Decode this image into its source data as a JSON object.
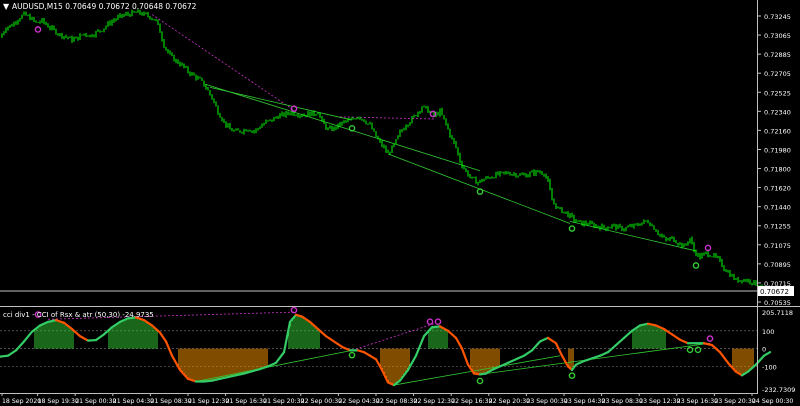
{
  "colors": {
    "background": "#000000",
    "candle": "#00ff00",
    "axis": "#c0c0c0",
    "text": "#ffffff",
    "divergence_line": "#cc33cc",
    "trend_line": "#33cc33",
    "cci_up": "#33cc66",
    "cci_down": "#ff5500",
    "hist_up": "#33cc33",
    "hist_down": "#ff9900",
    "bid_label_bg": "#ffffff"
  },
  "main_chart": {
    "header": "AUDUSD,M15  0.70649 0.70672 0.70648 0.70672",
    "bid_label": "0.70672",
    "price_labels": [
      "0.73245",
      "0.73065",
      "0.72885",
      "0.72705",
      "0.72525",
      "0.72340",
      "0.72160",
      "0.71980",
      "0.71800",
      "0.71620",
      "0.71440",
      "0.71255",
      "0.71075",
      "0.70895",
      "0.70715",
      "0.70535"
    ]
  },
  "indicator": {
    "header": "cci div1 - CCI of Rsx & atr (50,30) -24.9735",
    "level_labels": [
      "205.7118",
      "100",
      "0",
      "-100",
      "-232.7309"
    ]
  },
  "time_labels": [
    "18 Sep 2020",
    "18 Sep 19:30",
    "21 Sep 00:30",
    "21 Sep 04:30",
    "21 Sep 08:30",
    "21 Sep 12:30",
    "21 Sep 16:30",
    "21 Sep 20:30",
    "22 Sep 00:30",
    "22 Sep 04:30",
    "22 Sep 08:30",
    "22 Sep 12:30",
    "22 Sep 16:30",
    "22 Sep 20:30",
    "23 Sep 00:30",
    "23 Sep 04:30",
    "23 Sep 08:30",
    "23 Sep 12:30",
    "23 Sep 16:30",
    "23 Sep 20:30",
    "24 Sep 00:30"
  ],
  "chart_data": {
    "type": "candlestick",
    "symbol": "AUDUSD",
    "timeframe": "M15",
    "ohlc_last": {
      "open": 0.70649,
      "high": 0.70672,
      "low": 0.70648,
      "close": 0.70672
    },
    "ylim": [
      0.70535,
      0.73245
    ],
    "price_path": [
      [
        0,
        0.7302
      ],
      [
        6,
        0.7312
      ],
      [
        12,
        0.7314
      ],
      [
        18,
        0.732
      ],
      [
        24,
        0.7324
      ],
      [
        30,
        0.7321
      ],
      [
        36,
        0.7316
      ],
      [
        42,
        0.7318
      ],
      [
        48,
        0.7313
      ],
      [
        54,
        0.7309
      ],
      [
        60,
        0.7305
      ],
      [
        66,
        0.7303
      ],
      [
        72,
        0.73
      ],
      [
        78,
        0.7302
      ],
      [
        84,
        0.7306
      ],
      [
        90,
        0.7304
      ],
      [
        96,
        0.7307
      ],
      [
        102,
        0.731
      ],
      [
        108,
        0.7315
      ],
      [
        114,
        0.7319
      ],
      [
        120,
        0.7322
      ],
      [
        126,
        0.7324
      ],
      [
        132,
        0.7325
      ],
      [
        138,
        0.7326
      ],
      [
        144,
        0.7324
      ],
      [
        150,
        0.7322
      ],
      [
        156,
        0.7318
      ],
      [
        160,
        0.7308
      ],
      [
        164,
        0.7295
      ],
      [
        170,
        0.7285
      ],
      [
        176,
        0.728
      ],
      [
        182,
        0.7276
      ],
      [
        188,
        0.727
      ],
      [
        194,
        0.7266
      ],
      [
        200,
        0.7262
      ],
      [
        206,
        0.7255
      ],
      [
        212,
        0.7245
      ],
      [
        218,
        0.7232
      ],
      [
        224,
        0.7222
      ],
      [
        230,
        0.7215
      ],
      [
        236,
        0.7213
      ],
      [
        242,
        0.7214
      ],
      [
        248,
        0.7216
      ],
      [
        254,
        0.7213
      ],
      [
        260,
        0.7218
      ],
      [
        266,
        0.7222
      ],
      [
        272,
        0.7224
      ],
      [
        278,
        0.7228
      ],
      [
        284,
        0.7229
      ],
      [
        290,
        0.7231
      ],
      [
        296,
        0.723
      ],
      [
        302,
        0.7229
      ],
      [
        308,
        0.723
      ],
      [
        314,
        0.723
      ],
      [
        318,
        0.7232
      ],
      [
        322,
        0.7222
      ],
      [
        328,
        0.7215
      ],
      [
        334,
        0.7216
      ],
      [
        340,
        0.722
      ],
      [
        346,
        0.7223
      ],
      [
        352,
        0.7224
      ],
      [
        358,
        0.7228
      ],
      [
        364,
        0.7224
      ],
      [
        370,
        0.7219
      ],
      [
        376,
        0.7208
      ],
      [
        382,
        0.72
      ],
      [
        388,
        0.7192
      ],
      [
        394,
        0.72
      ],
      [
        400,
        0.7212
      ],
      [
        406,
        0.722
      ],
      [
        412,
        0.7225
      ],
      [
        418,
        0.7232
      ],
      [
        422,
        0.7237
      ],
      [
        428,
        0.7233
      ],
      [
        434,
        0.7228
      ],
      [
        440,
        0.7232
      ],
      [
        446,
        0.722
      ],
      [
        450,
        0.721
      ],
      [
        456,
        0.7198
      ],
      [
        460,
        0.7185
      ],
      [
        466,
        0.7175
      ],
      [
        472,
        0.7168
      ],
      [
        478,
        0.7165
      ],
      [
        484,
        0.7168
      ],
      [
        490,
        0.717
      ],
      [
        496,
        0.7172
      ],
      [
        502,
        0.7173
      ],
      [
        508,
        0.7174
      ],
      [
        514,
        0.7173
      ],
      [
        520,
        0.7172
      ],
      [
        526,
        0.7172
      ],
      [
        532,
        0.7174
      ],
      [
        538,
        0.7175
      ],
      [
        544,
        0.7174
      ],
      [
        548,
        0.7165
      ],
      [
        552,
        0.7148
      ],
      [
        558,
        0.714
      ],
      [
        564,
        0.7137
      ],
      [
        570,
        0.7133
      ],
      [
        576,
        0.7128
      ],
      [
        582,
        0.7126
      ],
      [
        588,
        0.7126
      ],
      [
        594,
        0.7124
      ],
      [
        600,
        0.7123
      ],
      [
        606,
        0.7122
      ],
      [
        612,
        0.7124
      ],
      [
        618,
        0.7122
      ],
      [
        624,
        0.7121
      ],
      [
        630,
        0.7123
      ],
      [
        636,
        0.7124
      ],
      [
        642,
        0.7127
      ],
      [
        648,
        0.7128
      ],
      [
        654,
        0.7122
      ],
      [
        660,
        0.7115
      ],
      [
        666,
        0.711
      ],
      [
        672,
        0.7112
      ],
      [
        678,
        0.7108
      ],
      [
        684,
        0.7104
      ],
      [
        690,
        0.7112
      ],
      [
        694,
        0.71
      ],
      [
        700,
        0.7094
      ],
      [
        706,
        0.7098
      ],
      [
        712,
        0.7096
      ],
      [
        718,
        0.7092
      ],
      [
        724,
        0.7084
      ],
      [
        730,
        0.7078
      ],
      [
        736,
        0.7072
      ],
      [
        742,
        0.7073
      ],
      [
        748,
        0.7072
      ],
      [
        754,
        0.707
      ],
      [
        760,
        0.7066
      ],
      [
        766,
        0.7062
      ],
      [
        770,
        0.7067
      ]
    ],
    "trend_lines": [
      {
        "kind": "divergence",
        "from": [
          152,
          0.7324
        ],
        "to": [
          296,
          0.7232
        ]
      },
      {
        "kind": "divergence",
        "from": [
          340,
          0.7227
        ],
        "to": [
          434,
          0.7225
        ]
      },
      {
        "kind": "trend",
        "from": [
          205,
          0.7258
        ],
        "to": [
          480,
          0.7176
        ]
      },
      {
        "kind": "trend",
        "from": [
          210,
          0.7255
        ],
        "to": [
          352,
          0.7224
        ]
      },
      {
        "kind": "trend",
        "from": [
          388,
          0.7192
        ],
        "to": [
          570,
          0.7126
        ]
      },
      {
        "kind": "trend",
        "from": [
          570,
          0.7128
        ],
        "to": [
          696,
          0.71
        ]
      }
    ],
    "arrows_main": [
      {
        "x": 38,
        "price": 0.7307,
        "kind": "top"
      },
      {
        "x": 294,
        "price": 0.7232,
        "kind": "top"
      },
      {
        "x": 433,
        "price": 0.7227,
        "kind": "top"
      },
      {
        "x": 708,
        "price": 0.71,
        "kind": "top"
      },
      {
        "x": 352,
        "price": 0.722,
        "kind": "bottom"
      },
      {
        "x": 480,
        "price": 0.716,
        "kind": "bottom"
      },
      {
        "x": 572,
        "price": 0.7125,
        "kind": "bottom"
      },
      {
        "x": 696,
        "price": 0.709,
        "kind": "bottom"
      }
    ],
    "indicator_ylim": [
      -232.7309,
      205.7118
    ],
    "indicator_levels": [
      100,
      0,
      -100
    ],
    "cci_path": [
      [
        0,
        -45
      ],
      [
        8,
        -40
      ],
      [
        16,
        -10
      ],
      [
        24,
        40
      ],
      [
        32,
        95
      ],
      [
        40,
        130
      ],
      [
        48,
        150
      ],
      [
        56,
        160
      ],
      [
        64,
        145
      ],
      [
        72,
        110
      ],
      [
        80,
        70
      ],
      [
        88,
        45
      ],
      [
        96,
        48
      ],
      [
        104,
        80
      ],
      [
        112,
        120
      ],
      [
        120,
        150
      ],
      [
        128,
        170
      ],
      [
        136,
        175
      ],
      [
        144,
        160
      ],
      [
        152,
        130
      ],
      [
        160,
        90
      ],
      [
        166,
        40
      ],
      [
        172,
        -40
      ],
      [
        180,
        -120
      ],
      [
        188,
        -170
      ],
      [
        196,
        -185
      ],
      [
        204,
        -185
      ],
      [
        212,
        -180
      ],
      [
        220,
        -170
      ],
      [
        228,
        -160
      ],
      [
        236,
        -150
      ],
      [
        244,
        -140
      ],
      [
        252,
        -128
      ],
      [
        260,
        -115
      ],
      [
        268,
        -100
      ],
      [
        276,
        -80
      ],
      [
        284,
        -20
      ],
      [
        290,
        150
      ],
      [
        296,
        190
      ],
      [
        302,
        180
      ],
      [
        310,
        150
      ],
      [
        318,
        110
      ],
      [
        326,
        70
      ],
      [
        334,
        40
      ],
      [
        342,
        10
      ],
      [
        350,
        -10
      ],
      [
        358,
        -10
      ],
      [
        364,
        -20
      ],
      [
        370,
        -40
      ],
      [
        376,
        -60
      ],
      [
        382,
        -120
      ],
      [
        388,
        -190
      ],
      [
        394,
        -205
      ],
      [
        400,
        -180
      ],
      [
        408,
        -120
      ],
      [
        416,
        -40
      ],
      [
        424,
        70
      ],
      [
        432,
        120
      ],
      [
        440,
        125
      ],
      [
        448,
        100
      ],
      [
        456,
        60
      ],
      [
        462,
        0
      ],
      [
        468,
        -90
      ],
      [
        474,
        -140
      ],
      [
        480,
        -145
      ],
      [
        486,
        -140
      ],
      [
        492,
        -120
      ],
      [
        500,
        -100
      ],
      [
        508,
        -80
      ],
      [
        516,
        -60
      ],
      [
        524,
        -40
      ],
      [
        532,
        -10
      ],
      [
        540,
        40
      ],
      [
        548,
        60
      ],
      [
        556,
        30
      ],
      [
        562,
        -40
      ],
      [
        568,
        -100
      ],
      [
        572,
        -120
      ],
      [
        576,
        -90
      ],
      [
        584,
        -70
      ],
      [
        592,
        -55
      ],
      [
        600,
        -40
      ],
      [
        608,
        -20
      ],
      [
        616,
        20
      ],
      [
        624,
        60
      ],
      [
        632,
        100
      ],
      [
        640,
        130
      ],
      [
        648,
        140
      ],
      [
        656,
        130
      ],
      [
        664,
        110
      ],
      [
        672,
        80
      ],
      [
        680,
        50
      ],
      [
        688,
        30
      ],
      [
        696,
        30
      ],
      [
        704,
        30
      ],
      [
        712,
        20
      ],
      [
        720,
        -20
      ],
      [
        728,
        -80
      ],
      [
        736,
        -130
      ],
      [
        742,
        -150
      ],
      [
        748,
        -130
      ],
      [
        756,
        -90
      ],
      [
        764,
        -40
      ],
      [
        770,
        -20
      ]
    ],
    "arrows_indicator": [
      {
        "x": 38,
        "value": 180,
        "kind": "top"
      },
      {
        "x": 294,
        "value": 205,
        "kind": "top"
      },
      {
        "x": 430,
        "value": 140,
        "kind": "top"
      },
      {
        "x": 438,
        "value": 140,
        "kind": "top"
      },
      {
        "x": 710,
        "value": 45,
        "kind": "top"
      },
      {
        "x": 352,
        "value": -20,
        "kind": "bottom"
      },
      {
        "x": 480,
        "value": -165,
        "kind": "bottom"
      },
      {
        "x": 572,
        "value": -135,
        "kind": "bottom"
      },
      {
        "x": 690,
        "value": 10,
        "kind": "bottom"
      },
      {
        "x": 698,
        "value": 10,
        "kind": "bottom"
      }
    ],
    "indicator_lines": [
      {
        "kind": "divergence",
        "from": [
          48,
          165
        ],
        "to": [
          294,
          205
        ]
      },
      {
        "kind": "divergence",
        "from": [
          352,
          -10
        ],
        "to": [
          434,
          140
        ]
      },
      {
        "kind": "trend",
        "from": [
          196,
          -185
        ],
        "to": [
          352,
          -10
        ]
      },
      {
        "kind": "trend",
        "from": [
          394,
          -205
        ],
        "to": [
          560,
          -40
        ]
      },
      {
        "kind": "trend",
        "from": [
          480,
          -145
        ],
        "to": [
          710,
          30
        ]
      }
    ]
  }
}
